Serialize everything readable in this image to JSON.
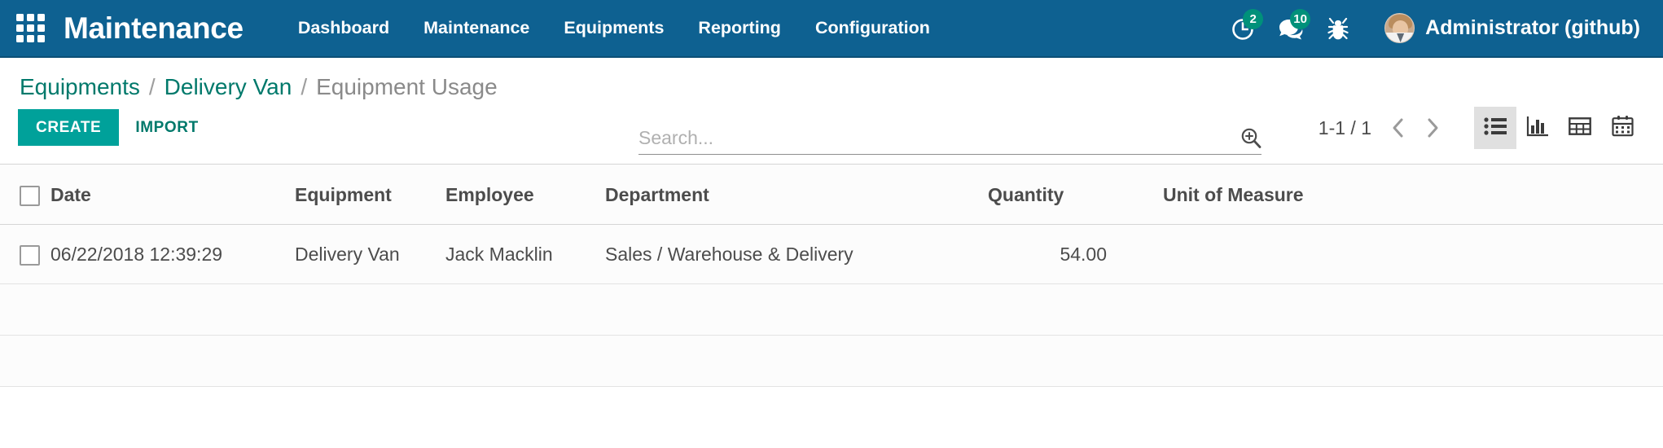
{
  "navbar": {
    "apps_icon": "apps-grid-icon",
    "brand": "Maintenance",
    "menu": [
      {
        "label": "Dashboard"
      },
      {
        "label": "Maintenance"
      },
      {
        "label": "Equipments"
      },
      {
        "label": "Reporting"
      },
      {
        "label": "Configuration"
      }
    ],
    "system_icons": [
      {
        "name": "activity-clock-icon",
        "badge": "2"
      },
      {
        "name": "messages-icon",
        "badge": "10"
      },
      {
        "name": "debug-bug-icon",
        "badge": ""
      }
    ],
    "user": {
      "name": "Administrator (github)",
      "avatar": "user-avatar"
    },
    "colors": {
      "background": "#0e6191",
      "border_bottom": "#0b4f76",
      "badge": "#00917a",
      "text": "#ffffff"
    }
  },
  "control_panel": {
    "breadcrumb": [
      {
        "label": "Equipments",
        "active": false
      },
      {
        "label": "Delivery Van",
        "active": false
      },
      {
        "label": "Equipment Usage",
        "active": true
      }
    ],
    "breadcrumb_separator": "/",
    "search": {
      "placeholder": "Search...",
      "value": "",
      "toggle_icon": "search-plus-icon"
    },
    "buttons": {
      "create_label": "CREATE",
      "import_label": "IMPORT"
    },
    "pager": {
      "value": "1-1 / 1",
      "previous_icon": "chevron-left-icon",
      "next_icon": "chevron-right-icon"
    },
    "view_switcher": [
      {
        "name": "list-view",
        "icon": "list-icon",
        "active": true
      },
      {
        "name": "graph-view",
        "icon": "bar-chart-icon",
        "active": false
      },
      {
        "name": "pivot-view",
        "icon": "pivot-table-icon",
        "active": false
      },
      {
        "name": "calendar-view",
        "icon": "calendar-icon",
        "active": false
      }
    ],
    "colors": {
      "link": "#00796b",
      "muted": "#8a8a8a",
      "create_button": "#00a19a"
    }
  },
  "list": {
    "columns": [
      {
        "key": "date",
        "label": "Date",
        "align": "left"
      },
      {
        "key": "equipment",
        "label": "Equipment",
        "align": "left"
      },
      {
        "key": "employee",
        "label": "Employee",
        "align": "left"
      },
      {
        "key": "department",
        "label": "Department",
        "align": "left"
      },
      {
        "key": "quantity",
        "label": "Quantity",
        "align": "right"
      },
      {
        "key": "uom",
        "label": "Unit of Measure",
        "align": "left"
      }
    ],
    "rows": [
      {
        "date": "06/22/2018 12:39:29",
        "equipment": "Delivery Van",
        "employee": "Jack Macklin",
        "department": "Sales / Warehouse & Delivery",
        "quantity": "54.00",
        "uom": ""
      }
    ],
    "empty_row_count": 2,
    "select_all_checkbox": false
  }
}
